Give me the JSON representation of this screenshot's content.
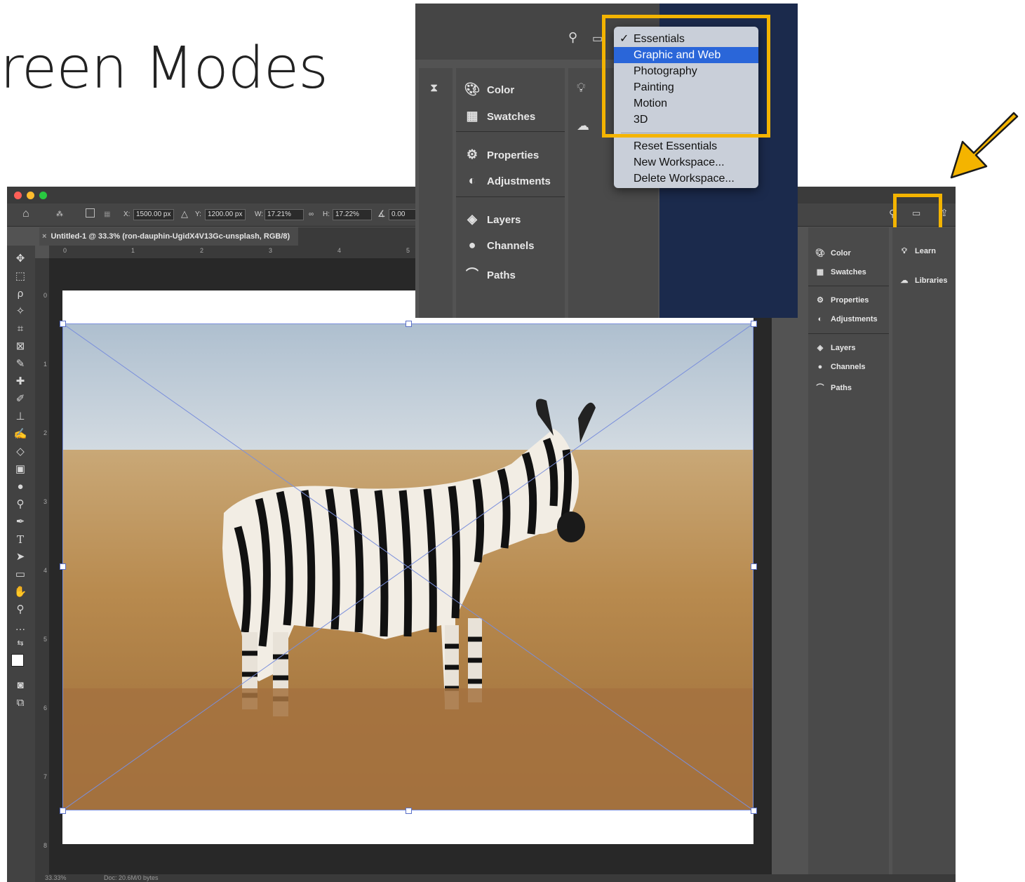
{
  "slide": {
    "title": "reen Modes"
  },
  "ps": {
    "options": {
      "x_label": "X:",
      "x_value": "1500.00 px",
      "y_label": "Y:",
      "y_value": "1200.00 px",
      "w_label": "W:",
      "w_value": "17.21%",
      "h_label": "H:",
      "h_value": "17.22%",
      "angle_value": "0.00"
    },
    "document_tab": "Untitled-1 @ 33.3% (ron-dauphin-UgidX4V13Gc-unsplash, RGB/8)",
    "ruler_h": [
      "0",
      "1",
      "2",
      "3",
      "4",
      "5"
    ],
    "ruler_v": [
      "0",
      "1",
      "2",
      "3",
      "4",
      "5",
      "6",
      "7",
      "8"
    ],
    "status": {
      "zoom": "33.33%",
      "doc": "Doc: 20.6M/0 bytes"
    },
    "panels_a": {
      "color": "Color",
      "swatches": "Swatches",
      "properties": "Properties",
      "adjustments": "Adjustments",
      "layers": "Layers",
      "channels": "Channels",
      "paths": "Paths"
    },
    "panels_b": {
      "learn": "Learn",
      "libraries": "Libraries"
    }
  },
  "workspace_menu": {
    "items": [
      "Essentials",
      "Graphic and Web",
      "Photography",
      "Painting",
      "Motion",
      "3D"
    ],
    "checked_index": 0,
    "selected_index": 1,
    "actions": [
      "Reset Essentials",
      "New Workspace...",
      "Delete Workspace..."
    ]
  },
  "colors": {
    "highlight": "#f4b400",
    "menu_selection": "#2a66d9",
    "panel_bg": "#535353"
  }
}
